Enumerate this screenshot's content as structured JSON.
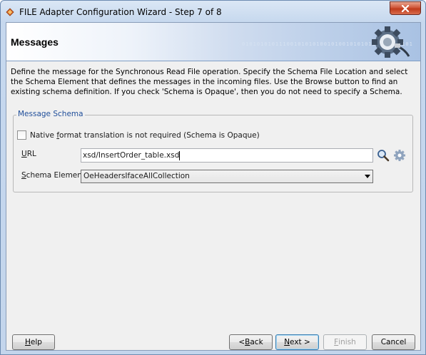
{
  "window": {
    "title": "FILE Adapter Configuration Wizard - Step 7 of 8"
  },
  "header": {
    "title": "Messages",
    "decoration_text": "0101010101110010101010010100101010110110010101",
    "icon": "gear-plug-icon"
  },
  "description": "Define the message for the Synchronous Read File operation.  Specify the Schema File Location and select the Schema Element that defines the messages in the incoming files. Use the Browse button to find an existing schema definition. If you check 'Schema is Opaque', then you do not need to specify a Schema.",
  "message_schema": {
    "legend": "Message Schema",
    "opaque_checkbox": {
      "label_before": "Native ",
      "label_mnemonic": "f",
      "label_after": "ormat translation is not required (Schema is Opaque)",
      "checked": false
    },
    "url": {
      "label_mnemonic": "U",
      "label_after": "RL",
      "value": "xsd/InsertOrder_table.xsd"
    },
    "schema_element": {
      "label_mnemonic": "S",
      "label_after": "chema Element",
      "value": "OeHeadersIfaceAllCollection"
    }
  },
  "buttons": {
    "help_mnemonic": "H",
    "help_after": "elp",
    "back_before": "< ",
    "back_mnemonic": "B",
    "back_after": "ack",
    "next_mnemonic": "N",
    "next_after": "ext >",
    "finish_mnemonic": "F",
    "finish_after": "inish",
    "cancel": "Cancel"
  },
  "colors": {
    "legend": "#1f4e9a",
    "close_button": "#c9472a",
    "header_gradient_end": "#a9c2e3"
  }
}
